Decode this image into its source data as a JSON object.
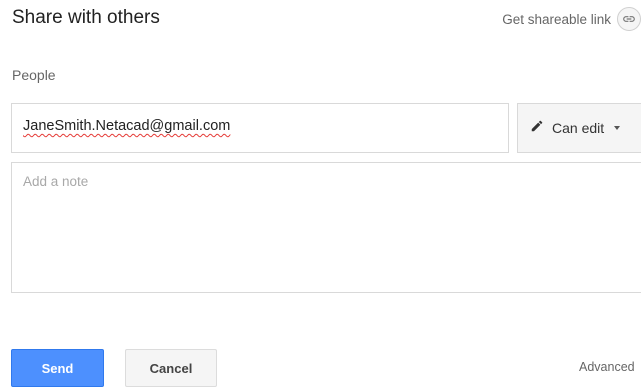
{
  "dialog": {
    "title": "Share with others",
    "share_link": {
      "label": "Get shareable link",
      "icon": "link-icon"
    }
  },
  "people": {
    "label": "People",
    "email_value": "JaneSmith.Netacad@gmail.com",
    "permission": {
      "label": "Can edit",
      "icon": "pencil-icon",
      "dropdown_icon": "caret-down-icon"
    }
  },
  "note": {
    "placeholder": "Add a note",
    "value": ""
  },
  "actions": {
    "send_label": "Send",
    "cancel_label": "Cancel",
    "advanced_label": "Advanced"
  },
  "colors": {
    "primary_button": "#4d90fe",
    "secondary_button": "#f5f5f5",
    "spellcheck_underline": "#e53935"
  }
}
